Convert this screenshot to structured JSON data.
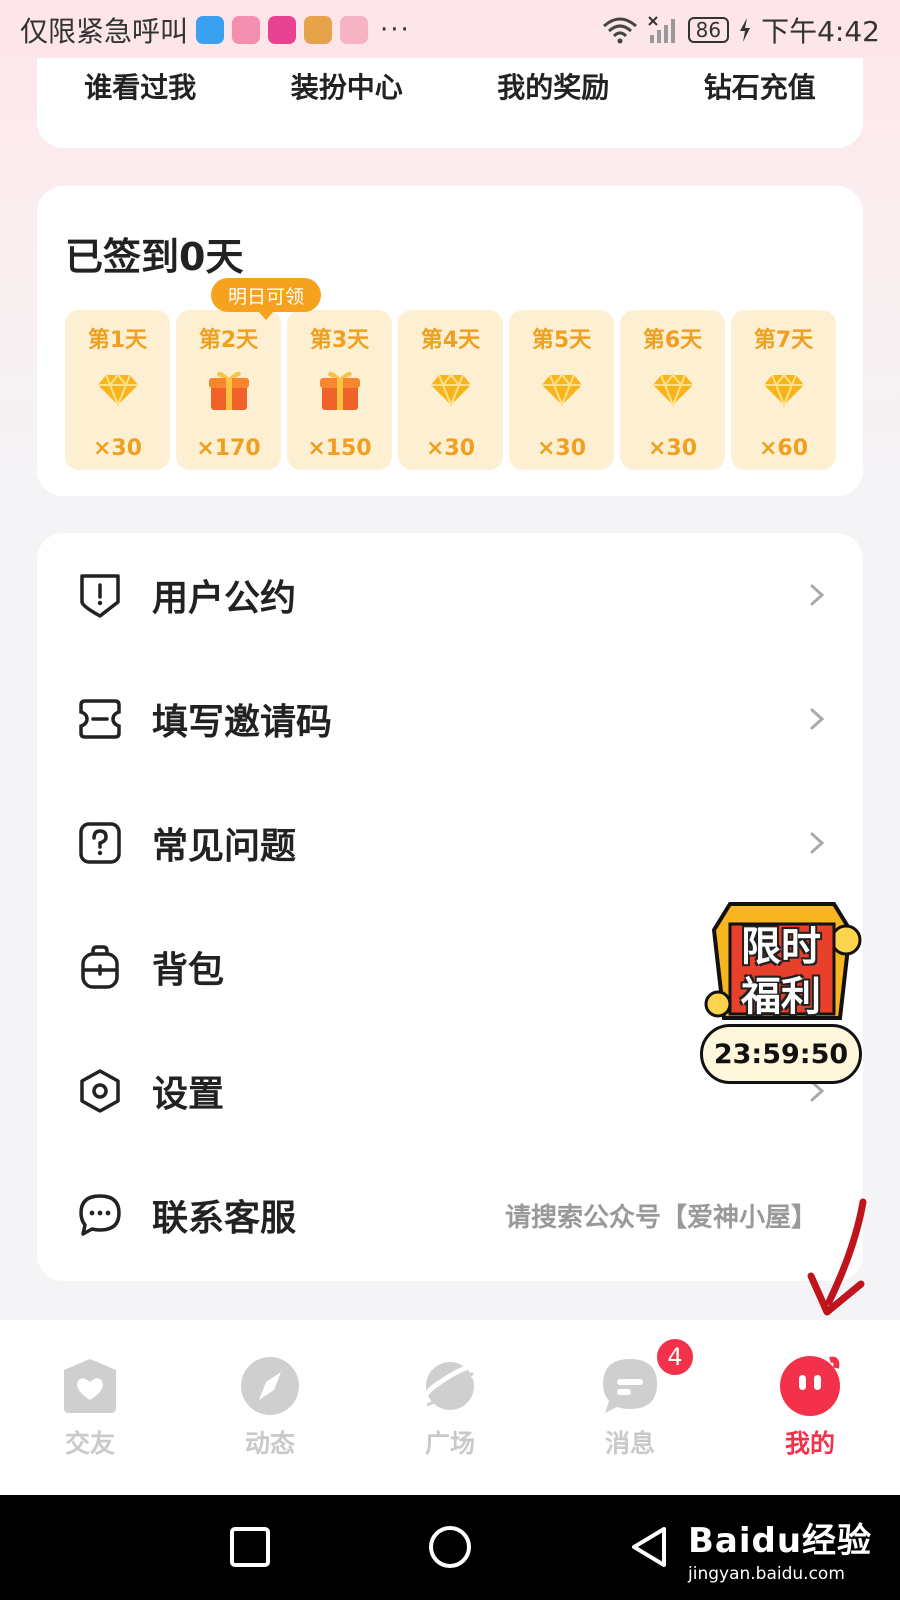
{
  "status_bar": {
    "carrier_text": "仅限紧急呼叫",
    "battery": "86",
    "time": "下午4:42",
    "more": "···"
  },
  "quick_links": [
    "谁看过我",
    "装扮中心",
    "我的奖励",
    "钻石充值"
  ],
  "checkin": {
    "title": "已签到0天",
    "tomorrow_badge": "明日可领",
    "days": [
      {
        "label": "第1天",
        "reward": "diamond-icon",
        "amount": "×30"
      },
      {
        "label": "第2天",
        "reward": "gift-icon",
        "amount": "×170"
      },
      {
        "label": "第3天",
        "reward": "gift-icon",
        "amount": "×150"
      },
      {
        "label": "第4天",
        "reward": "diamond-icon",
        "amount": "×30"
      },
      {
        "label": "第5天",
        "reward": "diamond-icon",
        "amount": "×30"
      },
      {
        "label": "第6天",
        "reward": "diamond-icon",
        "amount": "×30"
      },
      {
        "label": "第7天",
        "reward": "diamond-icon",
        "amount": "×60"
      }
    ]
  },
  "menu": {
    "items": [
      {
        "label": "用户公约",
        "icon": "shield-alert-icon"
      },
      {
        "label": "填写邀请码",
        "icon": "ticket-icon"
      },
      {
        "label": "常见问题",
        "icon": "question-icon"
      },
      {
        "label": "背包",
        "icon": "backpack-icon"
      },
      {
        "label": "设置",
        "icon": "settings-hexagon-icon"
      },
      {
        "label": "联系客服",
        "icon": "chat-bubble-icon",
        "hint": "请搜索公众号【爱神小屋】"
      }
    ]
  },
  "promo": {
    "line1": "限时",
    "line2": "福利",
    "timer": "23:59:50"
  },
  "bottom_nav": {
    "items": [
      {
        "label": "交友",
        "icon": "heart-house-icon"
      },
      {
        "label": "动态",
        "icon": "compass-icon"
      },
      {
        "label": "广场",
        "icon": "planet-icon"
      },
      {
        "label": "消息",
        "icon": "message-icon",
        "badge": "4"
      },
      {
        "label": "我的",
        "icon": "profile-face-icon",
        "active": true
      }
    ]
  },
  "watermark": {
    "main": "Baidu经验",
    "sub": "jingyan.baidu.com"
  },
  "colors": {
    "accent": "#f4314a",
    "reward_text": "#f0a020",
    "reward_bg": "#fdf0d2",
    "badge_orange": "#f7a21e"
  }
}
